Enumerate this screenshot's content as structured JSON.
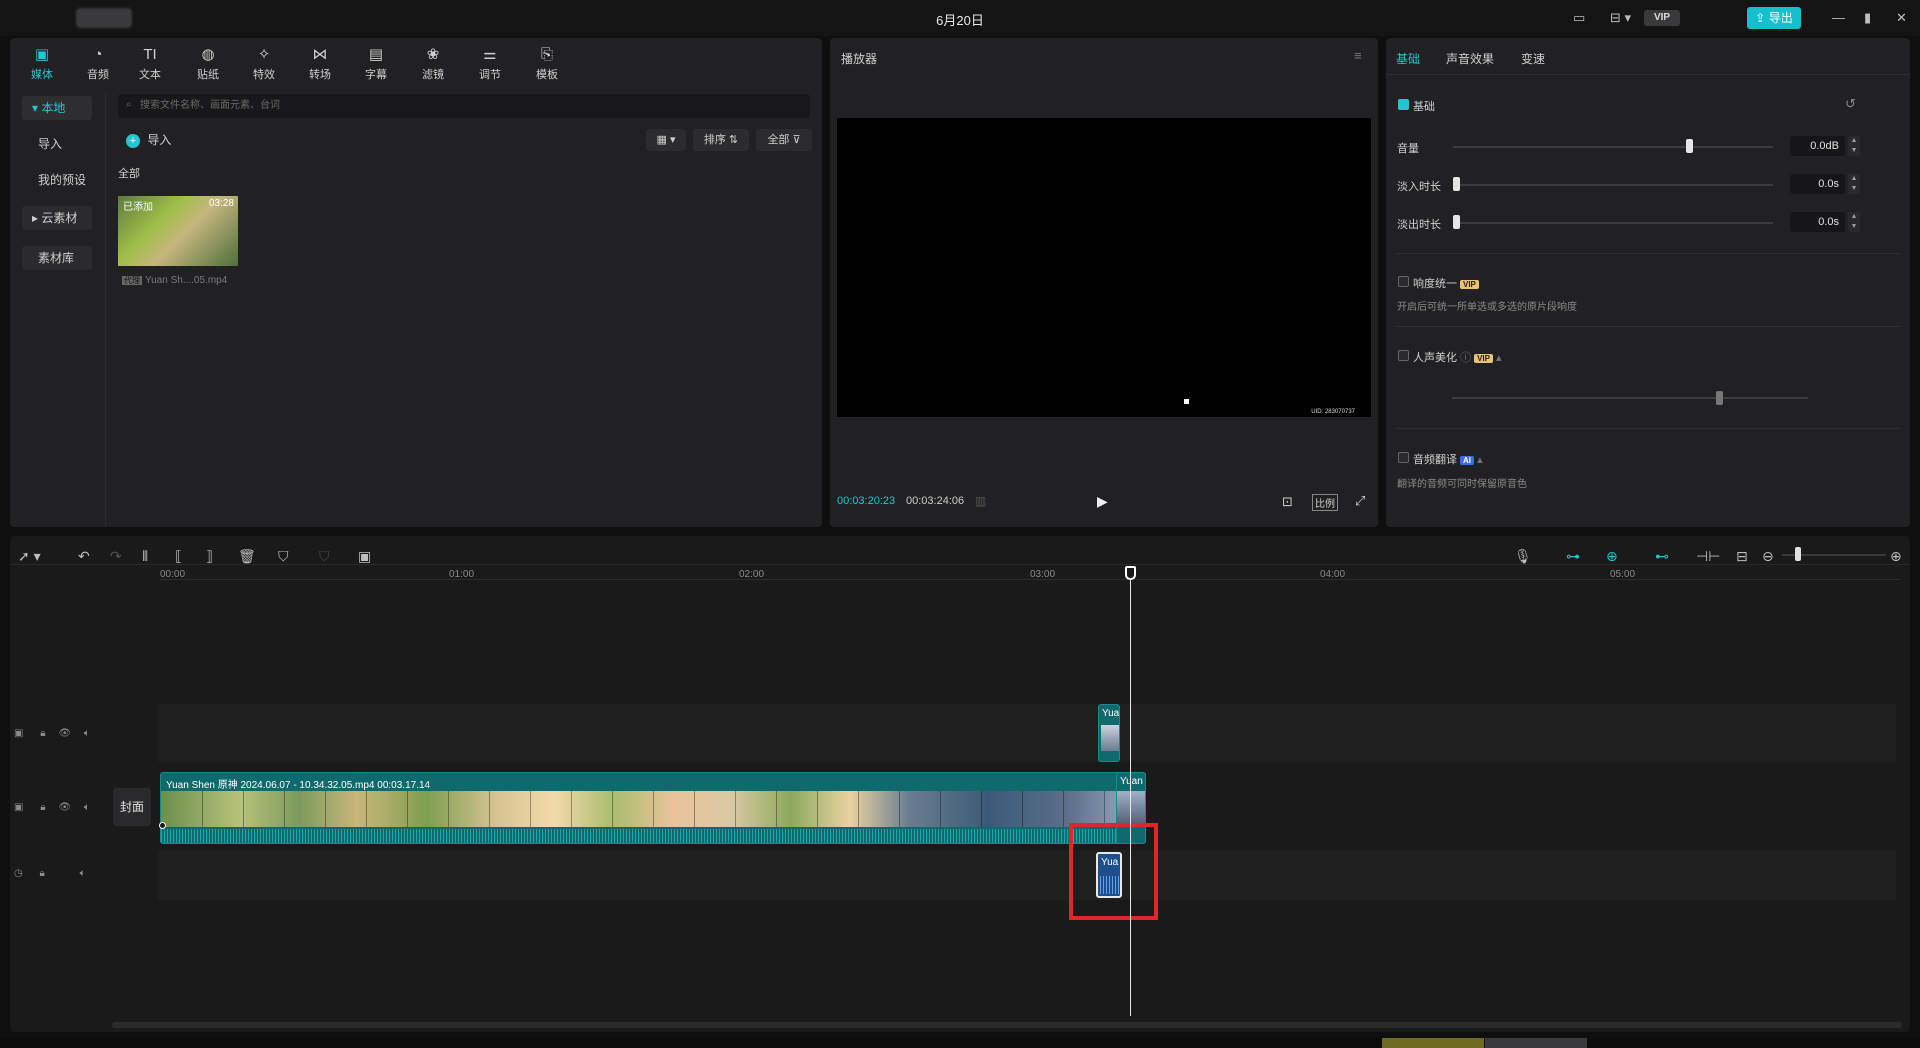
{
  "window": {
    "title": "6月20日",
    "vip": "VIP",
    "export_label": "导出"
  },
  "media_panel": {
    "tools": [
      {
        "label": "媒体",
        "icon": "media-icon"
      },
      {
        "label": "音频",
        "icon": "audio-icon"
      },
      {
        "label": "文本",
        "icon": "text-icon"
      },
      {
        "label": "贴纸",
        "icon": "sticker-icon"
      },
      {
        "label": "特效",
        "icon": "effects-icon"
      },
      {
        "label": "转场",
        "icon": "transition-icon"
      },
      {
        "label": "字幕",
        "icon": "caption-icon"
      },
      {
        "label": "滤镜",
        "icon": "filter-icon"
      },
      {
        "label": "调节",
        "icon": "adjust-icon"
      },
      {
        "label": "模板",
        "icon": "template-icon"
      }
    ],
    "sidebar": [
      {
        "label": "本地"
      },
      {
        "label": "导入"
      },
      {
        "label": "我的预设"
      },
      {
        "label": "云素材"
      },
      {
        "label": "素材库"
      }
    ],
    "search_placeholder": "搜索文件名称、画面元素、台词",
    "import_label": "导入",
    "sort_label": "排序",
    "filter_label": "全部",
    "section_label": "全部",
    "file": {
      "badge": "已添加",
      "duration": "03:28",
      "name": "Yuan Sh....05.mp4",
      "tag": "代理"
    }
  },
  "player": {
    "title": "播放器",
    "current_time": "00:03:20:23",
    "total_time": "00:03:24:06",
    "ratio_label": "比例",
    "uid": "UID: 283070737"
  },
  "right_panel": {
    "tabs": [
      "基础",
      "声音效果",
      "变速"
    ],
    "section_basic": "基础",
    "volume_label": "音量",
    "volume_value": "0.0dB",
    "fade_in_label": "淡入时长",
    "fade_in_value": "0.0s",
    "fade_out_label": "淡出时长",
    "fade_out_value": "0.0s",
    "loudness_label": "响度统一",
    "loudness_desc": "开启后可统一所单选或多选的原片段响度",
    "voice_beauty_label": "人声美化",
    "translate_label": "音频翻译",
    "translate_desc": "翻译的音频可同时保留原音色",
    "vip_badge": "VIP",
    "ai_badge": "AI"
  },
  "timeline": {
    "ruler": [
      "00:00",
      "01:00",
      "02:00",
      "03:00",
      "04:00",
      "05:00"
    ],
    "main_clip_label": "Yuan Shen 原神 2024.06.07 - 10.34.32.05.mp4   00:03.17.14",
    "cover_label": "封面",
    "small_clip_label": "Yua",
    "end_clip_label": "Yuan"
  }
}
